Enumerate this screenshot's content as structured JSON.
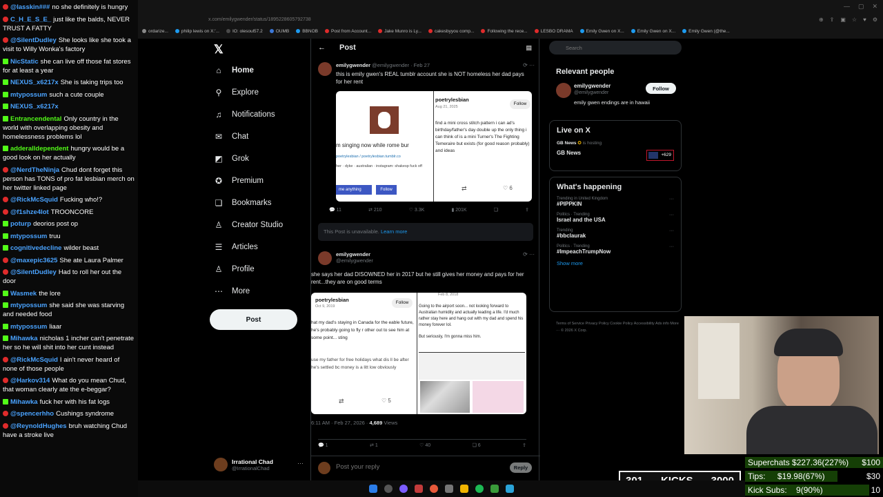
{
  "chat": {
    "messages": [
      {
        "platform": "yt",
        "user": "@lasskin###",
        "user_color": "blue",
        "text": "no she definitely is hungry"
      },
      {
        "platform": "yt",
        "user": "C_H_E_S_E_",
        "user_color": "blue",
        "text": "just like the balds, NEVER TRUST A FATTY"
      },
      {
        "platform": "yt",
        "user": "@SilentDudley",
        "user_color": "blue",
        "text": "She looks like she took a visit to Willy Wonka's factory"
      },
      {
        "platform": "kick",
        "user": "NicStatic",
        "user_color": "blue",
        "text": "she can live off those fat stores for at least a year"
      },
      {
        "platform": "kick",
        "user": "NEXUS_x6217x",
        "user_color": "blue",
        "text": "She is taking trips too"
      },
      {
        "platform": "kick",
        "user": "mtypossum",
        "user_color": "blue",
        "text": "such a cute couple"
      },
      {
        "platform": "kick",
        "user": "NEXUS_x6217x",
        "user_color": "blue",
        "text": ""
      },
      {
        "platform": "kick",
        "user": "Entrancendental",
        "user_color": "green",
        "text": "Only country in the world with overlapping obesity and homelessness problems lol"
      },
      {
        "platform": "kick",
        "user": "adderalldependent",
        "user_color": "green",
        "text": "hungry would be a good look on her actually"
      },
      {
        "platform": "yt",
        "user": "@NerdTheNinja",
        "user_color": "blue",
        "text": "Chud dont forget this person has TONS of pro fat lesbian merch on her twitter linked page"
      },
      {
        "platform": "yt",
        "user": "@RickMcSquid",
        "user_color": "blue",
        "text": "Fucking who!?"
      },
      {
        "platform": "yt",
        "user": "@f1shze4lot",
        "user_color": "blue",
        "text": "TROONCORE"
      },
      {
        "platform": "kick",
        "user": "poturp",
        "user_color": "blue",
        "text": "deorios post op"
      },
      {
        "platform": "kick",
        "user": "mtypossum",
        "user_color": "blue",
        "text": "truu"
      },
      {
        "platform": "kick",
        "user": "cognitivedecline",
        "user_color": "blue",
        "text": "wilder beast"
      },
      {
        "platform": "yt",
        "user": "@maxepic3625",
        "user_color": "blue",
        "text": "She ate Laura Palmer"
      },
      {
        "platform": "yt",
        "user": "@SilentDudley",
        "user_color": "blue",
        "text": "Had to roll her out the door"
      },
      {
        "platform": "kick",
        "user": "Wasmek",
        "user_color": "blue",
        "text": "the lore"
      },
      {
        "platform": "kick",
        "user": "mtypossum",
        "user_color": "blue",
        "text": "she said she was starving and needed food"
      },
      {
        "platform": "kick",
        "user": "mtypossum",
        "user_color": "blue",
        "text": "liaar"
      },
      {
        "platform": "kick",
        "user": "Mihawka",
        "user_color": "blue",
        "text": "nicholas 1 incher can't penetrate her so he will shit into her cunt instead"
      },
      {
        "platform": "yt",
        "user": "@RickMcSquid",
        "user_color": "blue",
        "text": "I ain't never heard of none of those people"
      },
      {
        "platform": "yt",
        "user": "@Harkov314",
        "user_color": "blue",
        "text": "What do you mean Chud, that woman clearly ate the e-beggar?"
      },
      {
        "platform": "kick",
        "user": "Mihawka",
        "user_color": "blue",
        "text": "fuck her with his fat logs"
      },
      {
        "platform": "yt",
        "user": "@spencerhho",
        "user_color": "blue",
        "text": "Cushings syndrome"
      },
      {
        "platform": "yt",
        "user": "@ReynoldHughes",
        "user_color": "blue",
        "text": "bruh watching Chud have a stroke live"
      }
    ]
  },
  "browser": {
    "url": "x.com/emilygwender/status/1895228605792738",
    "bookmarks": [
      "ordarize...",
      "philip lewis on X:'...",
      "IO: olesoul57.2",
      "OUMB",
      "BBNOB",
      "Post from Account...",
      "Jake Munro is Ly...",
      "cakesbyyou comp...",
      "Following the rece...",
      "LESBO DRAMA",
      "Emily Gwen on X...",
      "Emily Gwen on X...",
      "Emily Gwen (@the..."
    ]
  },
  "nav": {
    "items": [
      {
        "label": "Home",
        "icon": "home-icon",
        "glyph": "⌂"
      },
      {
        "label": "Explore",
        "icon": "search-icon",
        "glyph": "⚲"
      },
      {
        "label": "Notifications",
        "icon": "bell-icon",
        "glyph": "♫"
      },
      {
        "label": "Chat",
        "icon": "mail-icon",
        "glyph": "✉"
      },
      {
        "label": "Grok",
        "icon": "grok-icon",
        "glyph": "◩"
      },
      {
        "label": "Premium",
        "icon": "verified-icon",
        "glyph": "✪"
      },
      {
        "label": "Bookmarks",
        "icon": "bookmark-icon",
        "glyph": "❏"
      },
      {
        "label": "Creator Studio",
        "icon": "creator-icon",
        "glyph": "♙"
      },
      {
        "label": "Articles",
        "icon": "articles-icon",
        "glyph": "☰"
      },
      {
        "label": "Profile",
        "icon": "profile-icon",
        "glyph": "♙"
      },
      {
        "label": "More",
        "icon": "more-icon",
        "glyph": "⋯"
      }
    ],
    "post_label": "Post",
    "account_name": "Irrational Chad",
    "account_handle": "@IrrationalChad"
  },
  "main": {
    "title": "Post",
    "tweet1": {
      "name": "emilygwender",
      "handle": "@emilygwender · Feb 27",
      "text": "this is emily gwen's REAL tumblr account she is NOT homeless her dad pays for her rent",
      "embed_left_line1": "m singing now while rome bur",
      "embed_left_line2": "poetrylesbian / poetrylesbian.tumblr.co",
      "embed_left_line3": "her · dyke · australian · instagram: shakesp fuck off",
      "embed_btn1": "me anything",
      "embed_btn2": "Follow",
      "embed_right_user": "poetrylesbian",
      "embed_right_date": "Aug 21, 2025",
      "embed_right_follow": "Follow",
      "embed_right_text": "find a mini cross stitch pattern i can ad's birthday/father's day double up the only thing i can think of is a mini Turner's The Fighting Temeraire but exists (for good reason probably) and ideas",
      "embed_likes": "6",
      "stats": {
        "replies": "11",
        "reposts": "210",
        "likes": "3.3K",
        "views": "201K"
      }
    },
    "unavailable_text": "This Post is unavailable.",
    "unavailable_link": "Learn more",
    "tweet2": {
      "name": "emilygwender",
      "handle": "@emilygwender",
      "text": "she says her dad DISOWNED her in 2017 but he still gives her money and pays for her rent...they are on good terms",
      "embed_user": "poetrylesbian",
      "embed_date": "Oct 9, 2019",
      "embed_follow": "Follow",
      "embed_left_text": "hat my dad's staying in Canada for the eable future, he's probably going to fly r other out to see him at some point... sting",
      "embed_left_text2": "use my father for free holidays what dis ll be after he's settled bc money is a litt low obviously",
      "embed_right_date": "Feb 8, 2018",
      "embed_right_text": "Going to the airport soon... not looking forward to Australian humidity and actually leading a life. I'd much rather stay here and hang out with my dad and spend his money forever lol.",
      "embed_right_text2": "But seriously, I'm gonna miss him.",
      "embed_likes": "5",
      "timestamp": "6:11 AM · Feb 27, 2026 · ",
      "views_count": "4,689",
      "views_label": " Views",
      "stats": {
        "replies": "1",
        "reposts": "1",
        "likes": "40",
        "bookmarks": "6"
      }
    },
    "reply_placeholder": "Post your reply",
    "reply_label": "Reply"
  },
  "right": {
    "search_placeholder": "Search",
    "relevant_title": "Relevant people",
    "person_name": "emilygwender",
    "person_handle": "@emilygwender",
    "person_bio": "emily gwen endings are in hawaii",
    "person_follow": "Follow",
    "live_title": "Live on X",
    "live_host": "GB News",
    "live_host_suffix": " is hosting",
    "live_name": "GB News",
    "live_count": "+629",
    "happening_title": "What's happening",
    "trends": [
      {
        "cat": "Trending in United Kingdom",
        "name": "#PIPPKIN"
      },
      {
        "cat": "Politics · Trending",
        "name": "Israel and the USA"
      },
      {
        "cat": "Trending",
        "name": "#bbclaurak"
      },
      {
        "cat": "Politics · Trending",
        "name": "#ImpeachTrumpNow"
      }
    ],
    "show_more": "Show more",
    "footer": "Terms of Service   Privacy Policy   Cookie Policy   Accessibility   Ads info   More ···   © 2026 X Corp."
  },
  "overlay": {
    "kicks_count": "301",
    "kicks_label": "KICKS",
    "kicks_goal": "3000",
    "superchats_label": "Superchats",
    "superchats_value": "$227.36(227%)",
    "superchats_goal": "$100",
    "tips_label": "Tips:",
    "tips_value": "$19.98(67%)",
    "tips_goal": "$30",
    "tips_fraction": 0.67,
    "subs_label": "Kick Subs:",
    "subs_value": "9(90%)",
    "subs_goal": "10",
    "subs_fraction": 0.9
  }
}
